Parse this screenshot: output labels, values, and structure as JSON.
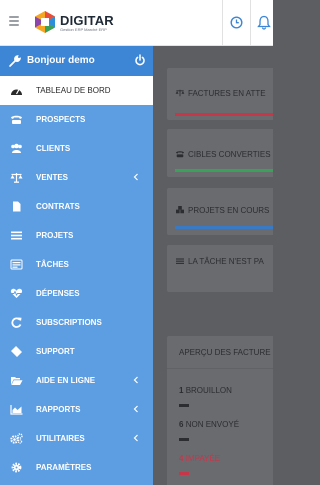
{
  "header": {
    "brand": "DIGITAR",
    "brand_sub": "Gestion ERP Marché ERP",
    "icons": [
      "hamburger-icon",
      "clock-icon",
      "bell-icon"
    ],
    "accent": "#3d86d6"
  },
  "sidebar": {
    "greeting": "Bonjour demo",
    "items": [
      {
        "label": "TABLEAU DE BORD",
        "icon": "dashboard-icon",
        "active": true
      },
      {
        "label": "PROSPECTS",
        "icon": "tty-icon"
      },
      {
        "label": "CLIENTS",
        "icon": "users-icon"
      },
      {
        "label": "VENTES",
        "icon": "balance-scale-icon",
        "submenu": true
      },
      {
        "label": "CONTRATS",
        "icon": "file-icon"
      },
      {
        "label": "PROJETS",
        "icon": "bars-icon"
      },
      {
        "label": "TÂCHES",
        "icon": "tasks-icon"
      },
      {
        "label": "DÉPENSES",
        "icon": "heartbeat-icon"
      },
      {
        "label": "SUBSCRIPTIONS",
        "icon": "refresh-icon"
      },
      {
        "label": "SUPPORT",
        "icon": "ticket-icon"
      },
      {
        "label": "AIDE EN LIGNE",
        "icon": "folder-open-icon",
        "submenu": true
      },
      {
        "label": "RAPPORTS",
        "icon": "area-chart-icon",
        "submenu": true
      },
      {
        "label": "UTILITAIRES",
        "icon": "cogs-icon",
        "submenu": true
      },
      {
        "label": "PARAMÈTRES",
        "icon": "cog-icon"
      }
    ],
    "colors": {
      "bg": "#5d9ee3",
      "user_bar": "#3d86d6",
      "active_bg": "#ffffff"
    }
  },
  "main": {
    "cards": [
      {
        "title": "FACTURES EN ATTE",
        "icon": "balance-scale-icon",
        "bar_color": "#c8364a"
      },
      {
        "title": "CIBLES CONVERTIES",
        "icon": "tty-icon",
        "bar_color": "#3aa05a"
      },
      {
        "title": "PROJETS EN COURS",
        "icon": "cubes-icon",
        "bar_color": "#3a79c4"
      },
      {
        "title": "LA TÂCHE N'EST PA",
        "icon": "tasks-icon",
        "bar_color": null
      }
    ],
    "overview": {
      "title": "APERÇU DES FACTURE",
      "items": [
        {
          "count": "1",
          "label": "BROUILLON",
          "color": "#2c2d30"
        },
        {
          "count": "6",
          "label": "NON ENVOYÉ",
          "color": "#2c2d30"
        },
        {
          "count": "4",
          "label": "IMPAYÉE",
          "color": "#c8364a"
        }
      ]
    }
  }
}
